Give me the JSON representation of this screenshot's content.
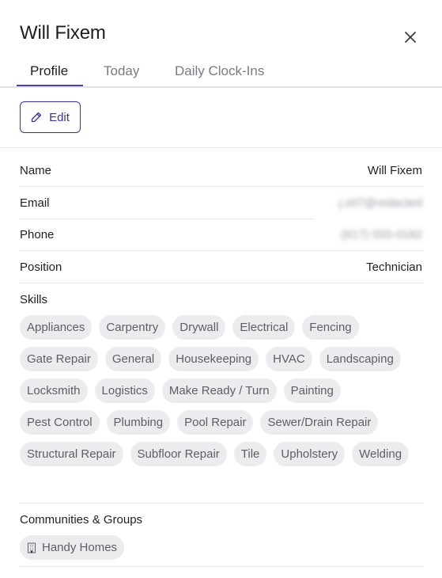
{
  "header": {
    "title": "Will Fixem",
    "close_icon": "close-icon"
  },
  "tabs": [
    {
      "label": "Profile",
      "active": true
    },
    {
      "label": "Today",
      "active": false
    },
    {
      "label": "Daily Clock-Ins",
      "active": false
    }
  ],
  "actions": {
    "edit_label": "Edit",
    "edit_icon": "pencil-icon"
  },
  "profile": {
    "name": {
      "label": "Name",
      "value": "Will Fixem"
    },
    "email": {
      "label": "Email",
      "value": "j.s07@redacted"
    },
    "phone": {
      "label": "Phone",
      "value": "(617) 555-0182"
    },
    "position": {
      "label": "Position",
      "value": "Technician"
    }
  },
  "skills": {
    "label": "Skills",
    "items": [
      "Appliances",
      "Carpentry",
      "Drywall",
      "Electrical",
      "Fencing",
      "Gate Repair",
      "General",
      "Housekeeping",
      "HVAC",
      "Landscaping",
      "Locksmith",
      "Logistics",
      "Make Ready / Turn",
      "Painting",
      "Pest Control",
      "Plumbing",
      "Pool Repair",
      "Sewer/Drain Repair",
      "Structural Repair",
      "Subfloor Repair",
      "Tile",
      "Upholstery",
      "Welding"
    ]
  },
  "communities": {
    "label": "Communities & Groups",
    "items": [
      {
        "label": "Handy Homes",
        "icon": "building-icon"
      }
    ]
  },
  "colors": {
    "accent": "#3f3296",
    "chip_bg": "#ececef",
    "divider": "#e3e3e8"
  }
}
